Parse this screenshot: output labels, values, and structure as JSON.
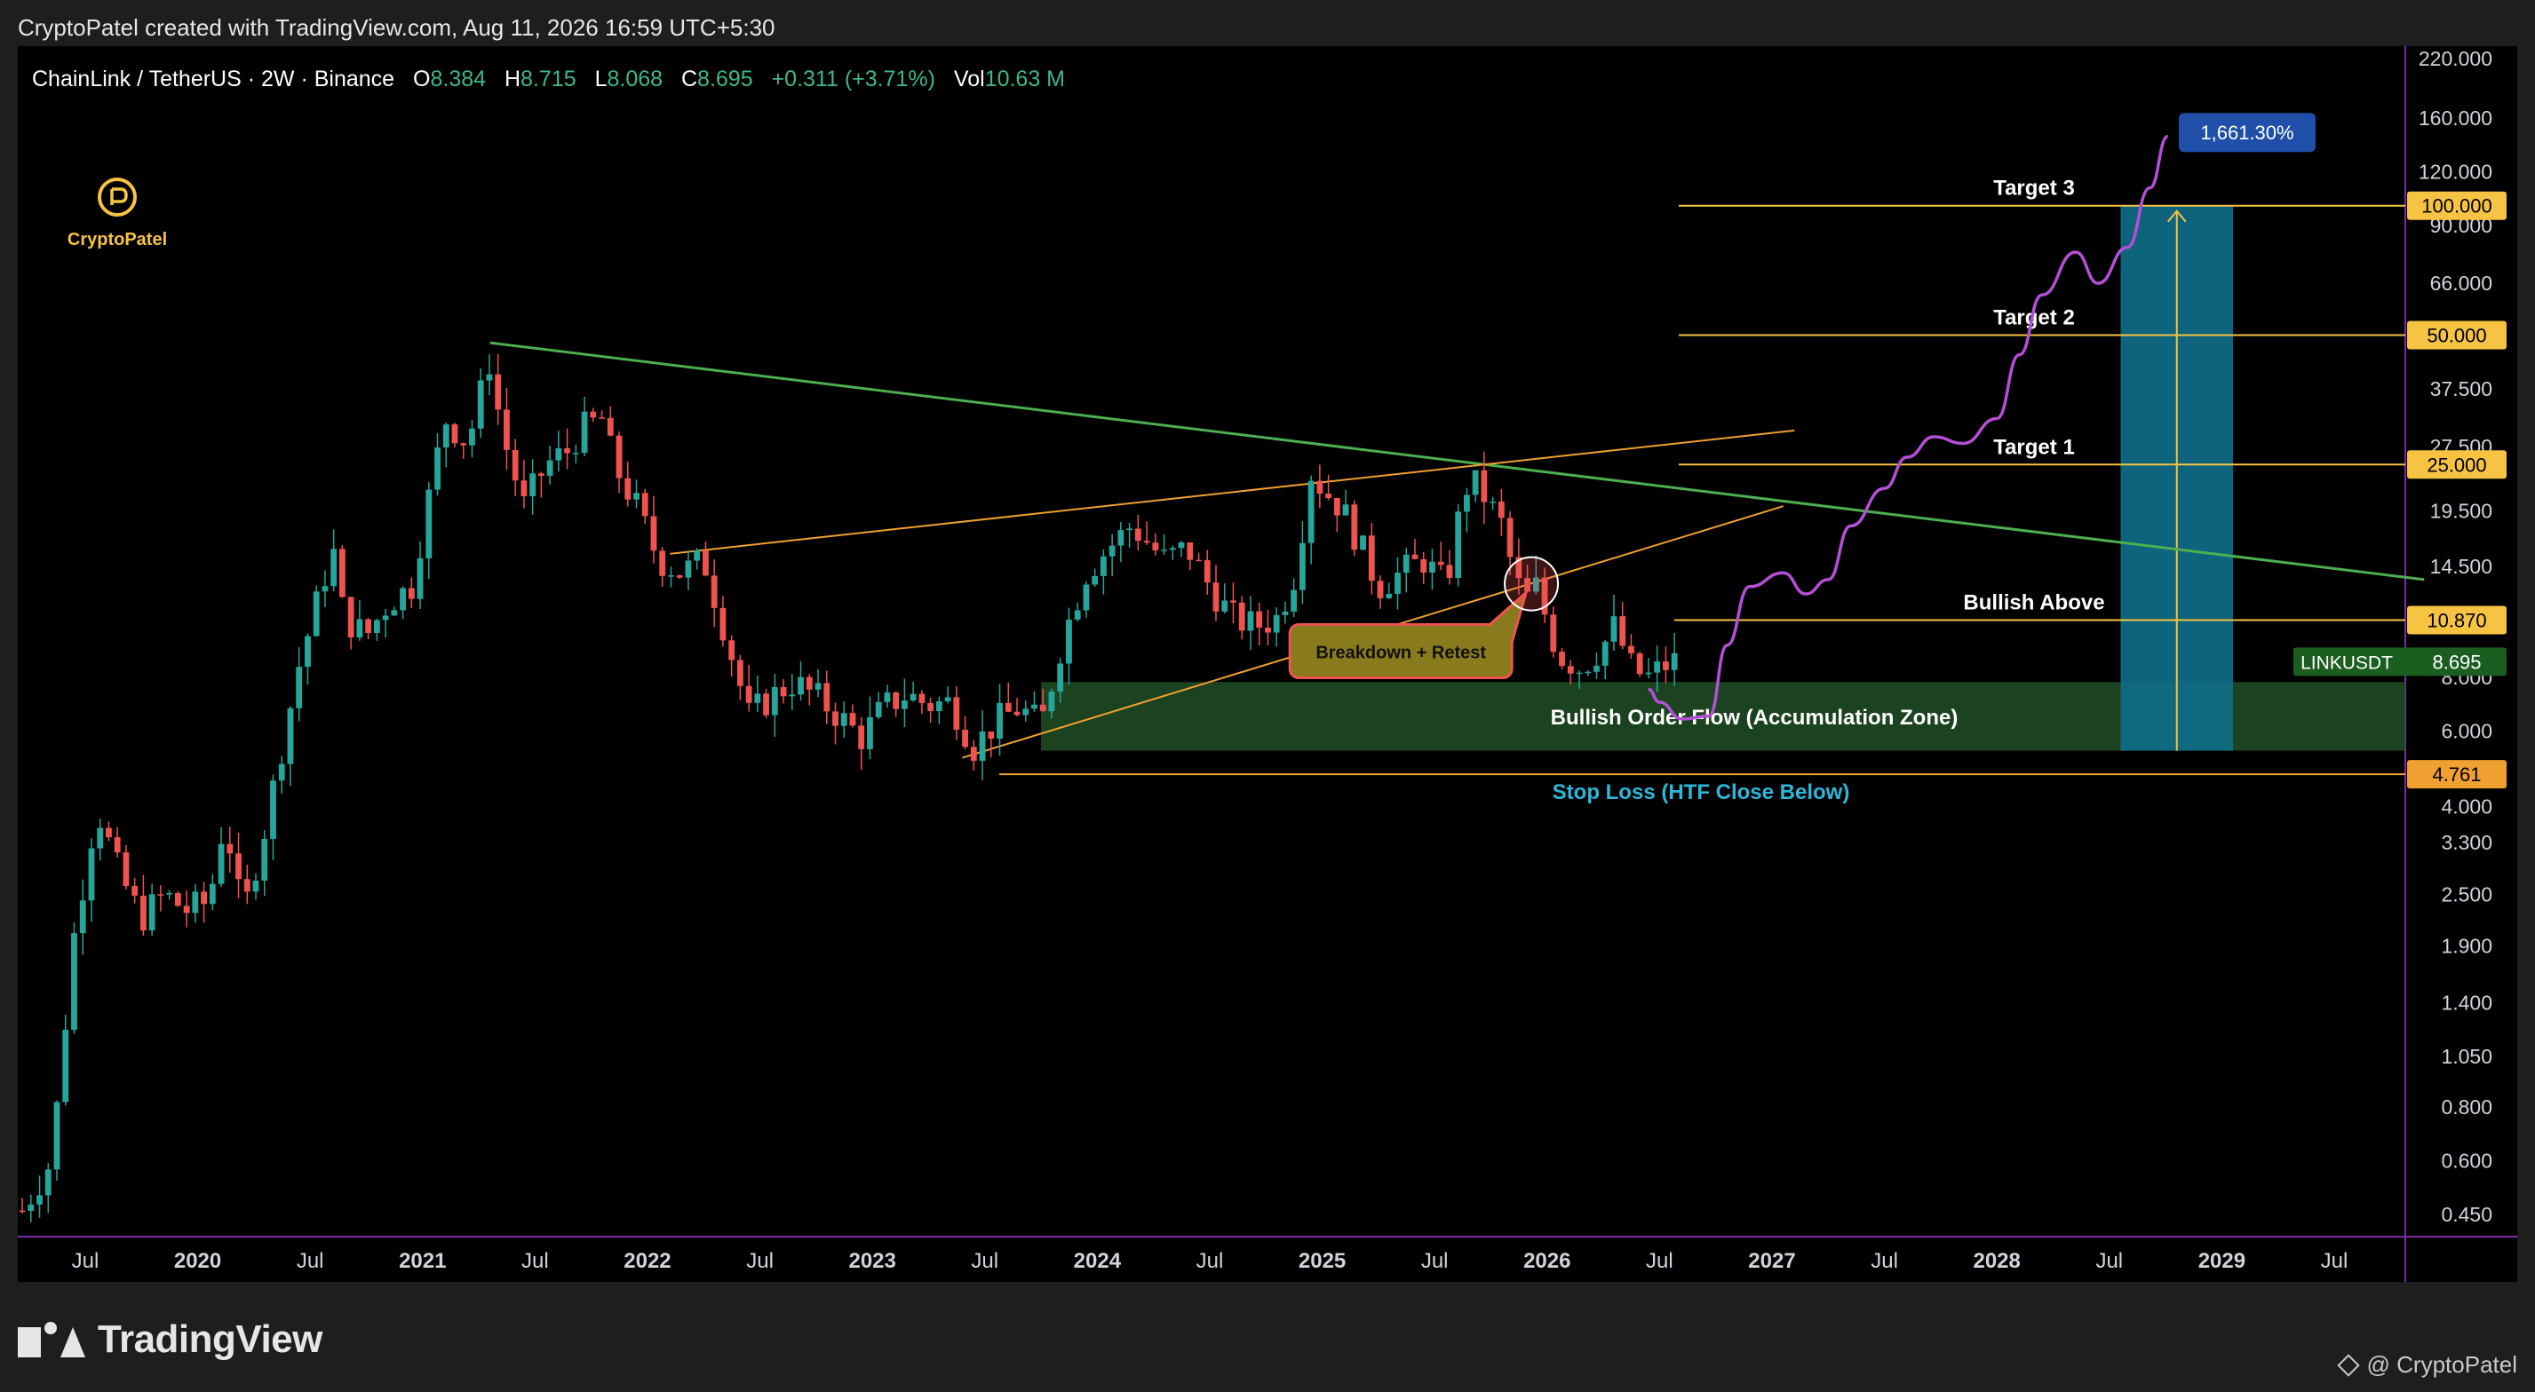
{
  "header": {
    "caption": "CryptoPatel created with TradingView.com, Aug 11, 2026 16:59 UTC+5:30"
  },
  "footer": {
    "brand": "TradingView",
    "author": "@ CryptoPatel"
  },
  "watermark": {
    "name": "CryptoPatel"
  },
  "symbol_bar": {
    "symbol": "ChainLink / TetherUS · 2W · Binance",
    "open_label": "O",
    "open": "8.384",
    "high_label": "H",
    "high": "8.715",
    "low_label": "L",
    "low": "8.068",
    "close_label": "C",
    "close": "8.695",
    "change": "+0.311 (+3.71%)",
    "vol_label": "Vol",
    "vol": "10.63 M"
  },
  "colors": {
    "up": "#26a69a",
    "down": "#ef5350",
    "background": "#000000",
    "level": "#f6c343",
    "trend": "#4caf50",
    "projection": "#b44fd6",
    "zone": "#1f4a22",
    "target_box": "#0f6f8a"
  },
  "chart_data": {
    "type": "candlestick",
    "symbol": "LINKUSDT",
    "y_scale": "log",
    "ylim": [
      0.4,
      220
    ],
    "y_ticks": [
      "220.000",
      "160.000",
      "120.000",
      "90.000",
      "66.000",
      "50.000",
      "37.500",
      "27.500",
      "25.000",
      "19.500",
      "14.500",
      "10.870",
      "8.000",
      "6.000",
      "4.761",
      "4.000",
      "3.300",
      "2.500",
      "1.900",
      "1.400",
      "1.050",
      "0.800",
      "0.600",
      "0.450"
    ],
    "y_tick_values": [
      220,
      160,
      120,
      90,
      66,
      50,
      37.5,
      27.5,
      25,
      19.5,
      14.5,
      10.87,
      8,
      6,
      4.761,
      4,
      3.3,
      2.5,
      1.9,
      1.4,
      1.05,
      0.8,
      0.6,
      0.45
    ],
    "x_range": [
      2019.2,
      2029.5
    ],
    "x_ticks": [
      {
        "label": "Jul",
        "t": 2019.5,
        "bold": false
      },
      {
        "label": "2020",
        "t": 2020.0,
        "bold": true
      },
      {
        "label": "Jul",
        "t": 2020.5,
        "bold": false
      },
      {
        "label": "2021",
        "t": 2021.0,
        "bold": true
      },
      {
        "label": "Jul",
        "t": 2021.5,
        "bold": false
      },
      {
        "label": "2022",
        "t": 2022.0,
        "bold": true
      },
      {
        "label": "Jul",
        "t": 2022.5,
        "bold": false
      },
      {
        "label": "2023",
        "t": 2023.0,
        "bold": true
      },
      {
        "label": "Jul",
        "t": 2023.5,
        "bold": false
      },
      {
        "label": "2024",
        "t": 2024.0,
        "bold": true
      },
      {
        "label": "Jul",
        "t": 2024.5,
        "bold": false
      },
      {
        "label": "2025",
        "t": 2025.0,
        "bold": true
      },
      {
        "label": "Jul",
        "t": 2025.5,
        "bold": false
      },
      {
        "label": "2026",
        "t": 2026.0,
        "bold": true
      },
      {
        "label": "Jul",
        "t": 2026.5,
        "bold": false
      },
      {
        "label": "2027",
        "t": 2027.0,
        "bold": true
      },
      {
        "label": "Jul",
        "t": 2027.5,
        "bold": false
      },
      {
        "label": "2028",
        "t": 2028.0,
        "bold": true
      },
      {
        "label": "Jul",
        "t": 2028.5,
        "bold": false
      },
      {
        "label": "2029",
        "t": 2029.0,
        "bold": true
      },
      {
        "label": "Jul",
        "t": 2029.5,
        "bold": false
      }
    ],
    "price_path": [
      {
        "t": 2019.22,
        "p": 0.46
      },
      {
        "t": 2019.35,
        "p": 0.6
      },
      {
        "t": 2019.45,
        "p": 2.0
      },
      {
        "t": 2019.55,
        "p": 4.0
      },
      {
        "t": 2019.65,
        "p": 2.8
      },
      {
        "t": 2019.75,
        "p": 2.2
      },
      {
        "t": 2019.85,
        "p": 2.5
      },
      {
        "t": 2019.95,
        "p": 2.3
      },
      {
        "t": 2020.05,
        "p": 2.4
      },
      {
        "t": 2020.12,
        "p": 3.8
      },
      {
        "t": 2020.2,
        "p": 2.2
      },
      {
        "t": 2020.3,
        "p": 3.6
      },
      {
        "t": 2020.45,
        "p": 8.5
      },
      {
        "t": 2020.6,
        "p": 16
      },
      {
        "t": 2020.65,
        "p": 11
      },
      {
        "t": 2020.75,
        "p": 10
      },
      {
        "t": 2020.85,
        "p": 12
      },
      {
        "t": 2020.95,
        "p": 13
      },
      {
        "t": 2021.05,
        "p": 24
      },
      {
        "t": 2021.1,
        "p": 32
      },
      {
        "t": 2021.2,
        "p": 28
      },
      {
        "t": 2021.3,
        "p": 44
      },
      {
        "t": 2021.35,
        "p": 30
      },
      {
        "t": 2021.45,
        "p": 20
      },
      {
        "t": 2021.55,
        "p": 25
      },
      {
        "t": 2021.65,
        "p": 27
      },
      {
        "t": 2021.7,
        "p": 30
      },
      {
        "t": 2021.8,
        "p": 32
      },
      {
        "t": 2021.85,
        "p": 25
      },
      {
        "t": 2021.95,
        "p": 20
      },
      {
        "t": 2022.05,
        "p": 15
      },
      {
        "t": 2022.15,
        "p": 14
      },
      {
        "t": 2022.25,
        "p": 15
      },
      {
        "t": 2022.35,
        "p": 10
      },
      {
        "t": 2022.45,
        "p": 6.5
      },
      {
        "t": 2022.55,
        "p": 7.2
      },
      {
        "t": 2022.65,
        "p": 7.8
      },
      {
        "t": 2022.75,
        "p": 7.2
      },
      {
        "t": 2022.85,
        "p": 6.5
      },
      {
        "t": 2022.95,
        "p": 5.8
      },
      {
        "t": 2023.05,
        "p": 6.8
      },
      {
        "t": 2023.15,
        "p": 7.3
      },
      {
        "t": 2023.25,
        "p": 6.9
      },
      {
        "t": 2023.35,
        "p": 7.0
      },
      {
        "t": 2023.45,
        "p": 5.5
      },
      {
        "t": 2023.55,
        "p": 6.3
      },
      {
        "t": 2023.65,
        "p": 6.8
      },
      {
        "t": 2023.75,
        "p": 6.2
      },
      {
        "t": 2023.85,
        "p": 10
      },
      {
        "t": 2023.95,
        "p": 14
      },
      {
        "t": 2024.05,
        "p": 16
      },
      {
        "t": 2024.15,
        "p": 18
      },
      {
        "t": 2024.2,
        "p": 17
      },
      {
        "t": 2024.3,
        "p": 15
      },
      {
        "t": 2024.4,
        "p": 16
      },
      {
        "t": 2024.5,
        "p": 13
      },
      {
        "t": 2024.6,
        "p": 11
      },
      {
        "t": 2024.7,
        "p": 10.5
      },
      {
        "t": 2024.8,
        "p": 11
      },
      {
        "t": 2024.88,
        "p": 14
      },
      {
        "t": 2024.95,
        "p": 24
      },
      {
        "t": 2025.0,
        "p": 22
      },
      {
        "t": 2025.08,
        "p": 20
      },
      {
        "t": 2025.15,
        "p": 17
      },
      {
        "t": 2025.25,
        "p": 13
      },
      {
        "t": 2025.35,
        "p": 14
      },
      {
        "t": 2025.45,
        "p": 15
      },
      {
        "t": 2025.55,
        "p": 13
      },
      {
        "t": 2025.6,
        "p": 18
      },
      {
        "t": 2025.65,
        "p": 23
      },
      {
        "t": 2025.7,
        "p": 22
      },
      {
        "t": 2025.8,
        "p": 18
      },
      {
        "t": 2025.85,
        "p": 14
      },
      {
        "t": 2025.9,
        "p": 12
      },
      {
        "t": 2025.95,
        "p": 13
      },
      {
        "t": 2026.05,
        "p": 9.0
      },
      {
        "t": 2026.15,
        "p": 8.4
      },
      {
        "t": 2026.25,
        "p": 9.5
      },
      {
        "t": 2026.3,
        "p": 10.5
      },
      {
        "t": 2026.38,
        "p": 8.3
      },
      {
        "t": 2026.45,
        "p": 8.0
      },
      {
        "t": 2026.55,
        "p": 8.7
      },
      {
        "t": 2026.6,
        "p": 8.695
      }
    ],
    "projection_path": [
      {
        "t": 2026.45,
        "p": 7.5
      },
      {
        "t": 2026.5,
        "p": 7.0
      },
      {
        "t": 2026.6,
        "p": 6.4
      },
      {
        "t": 2026.72,
        "p": 6.5
      },
      {
        "t": 2026.8,
        "p": 9.5
      },
      {
        "t": 2026.9,
        "p": 13
      },
      {
        "t": 2027.05,
        "p": 14
      },
      {
        "t": 2027.15,
        "p": 12.5
      },
      {
        "t": 2027.25,
        "p": 13.5
      },
      {
        "t": 2027.35,
        "p": 18
      },
      {
        "t": 2027.5,
        "p": 22
      },
      {
        "t": 2027.6,
        "p": 26
      },
      {
        "t": 2027.72,
        "p": 29
      },
      {
        "t": 2027.85,
        "p": 28
      },
      {
        "t": 2028.0,
        "p": 32
      },
      {
        "t": 2028.1,
        "p": 45
      },
      {
        "t": 2028.2,
        "p": 62
      },
      {
        "t": 2028.35,
        "p": 78
      },
      {
        "t": 2028.45,
        "p": 66
      },
      {
        "t": 2028.58,
        "p": 80
      },
      {
        "t": 2028.68,
        "p": 110
      },
      {
        "t": 2028.76,
        "p": 145
      }
    ],
    "levels": [
      {
        "name": "Target 3",
        "value": 100,
        "tag": "100.000"
      },
      {
        "name": "Target 2",
        "value": 50,
        "tag": "50.000"
      },
      {
        "name": "Target 1",
        "value": 25,
        "tag": "25.000"
      },
      {
        "name": "Bullish Above",
        "value": 10.87,
        "tag": "10.870"
      },
      {
        "name": "Stop Loss (HTF Close Below)",
        "value": 4.761,
        "tag": "4.761"
      }
    ],
    "current_price": {
      "symbol": "LINKUSDT",
      "value": 8.695,
      "tag": "8.695"
    },
    "zone": {
      "label": "Bullish Order Flow (Accumulation Zone)",
      "low": 5.4,
      "high": 7.8,
      "t_start": 2023.75
    },
    "projection_gain": "1,661.30%",
    "target_box": {
      "t_start": 2028.55,
      "t_end": 2029.05,
      "low": 5.4,
      "high": 100
    },
    "annotation": {
      "label": "Breakdown + Retest",
      "t": 2025.35,
      "p": 9.2,
      "circle_t": 2025.93,
      "circle_p": 13.2
    },
    "trendlines": [
      {
        "kind": "descending",
        "t1": 2021.3,
        "p1": 48,
        "t2": 2029.9,
        "p2": 13.5
      },
      {
        "kind": "upper-channel",
        "t1": 2022.1,
        "p1": 15.5,
        "t2": 2027.1,
        "p2": 30
      },
      {
        "kind": "lower-channel",
        "t1": 2023.4,
        "p1": 5.2,
        "t2": 2027.05,
        "p2": 20
      }
    ]
  }
}
